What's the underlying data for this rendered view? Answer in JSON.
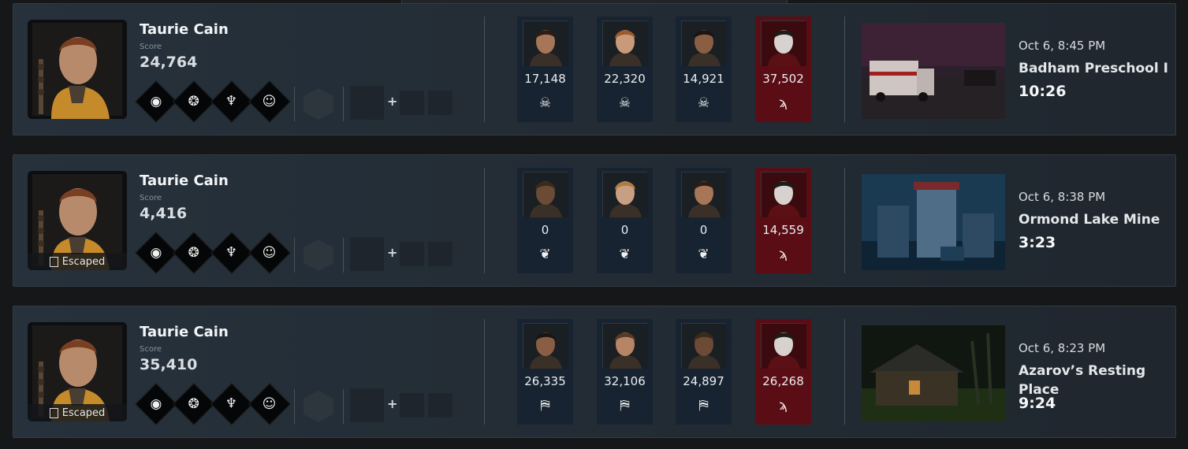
{
  "matches": [
    {
      "player_name": "Taurie Cain",
      "score_label": "Score",
      "score": "24,764",
      "escaped": "",
      "perks": [
        "eye-icon",
        "tentacles-icon",
        "figure-icon",
        "head-icon"
      ],
      "teammates": [
        {
          "score": "17,148",
          "status_icon": "skull-icon",
          "killer": false
        },
        {
          "score": "22,320",
          "status_icon": "skull-icon",
          "killer": false
        },
        {
          "score": "14,921",
          "status_icon": "skull-icon",
          "killer": false
        },
        {
          "score": "37,502",
          "status_icon": "claw-icon",
          "killer": true
        }
      ],
      "date": "Oct 6, 8:45 PM",
      "map": "Badham Preschool I",
      "duration": "10:26"
    },
    {
      "player_name": "Taurie Cain",
      "score_label": "Score",
      "score": "4,416",
      "escaped": "Escaped",
      "perks": [
        "eye-icon",
        "tentacles-icon",
        "figure-icon",
        "head-icon"
      ],
      "teammates": [
        {
          "score": "0",
          "status_icon": "sacrifice-icon",
          "killer": false
        },
        {
          "score": "0",
          "status_icon": "sacrifice-icon",
          "killer": false
        },
        {
          "score": "0",
          "status_icon": "sacrifice-icon",
          "killer": false
        },
        {
          "score": "14,559",
          "status_icon": "claw-icon",
          "killer": true
        }
      ],
      "date": "Oct 6, 8:38 PM",
      "map": "Ormond Lake Mine",
      "duration": "3:23"
    },
    {
      "player_name": "Taurie Cain",
      "score_label": "Score",
      "score": "35,410",
      "escaped": "Escaped",
      "perks": [
        "eye-icon",
        "tentacles-icon",
        "figure-icon",
        "head-icon"
      ],
      "teammates": [
        {
          "score": "26,335",
          "status_icon": "escape-door-icon",
          "killer": false
        },
        {
          "score": "32,106",
          "status_icon": "escape-door-icon",
          "killer": false
        },
        {
          "score": "24,897",
          "status_icon": "escape-door-icon",
          "killer": false
        },
        {
          "score": "26,268",
          "status_icon": "claw-icon",
          "killer": true
        }
      ],
      "date": "Oct 6, 8:23 PM",
      "map": "Azarov’s Resting Place",
      "duration": "9:24"
    }
  ],
  "plus_sign": "+",
  "colors": {
    "killer_bg": "#5a0d14",
    "survivor_bg": "#172330",
    "card_bg": "#26313b"
  }
}
